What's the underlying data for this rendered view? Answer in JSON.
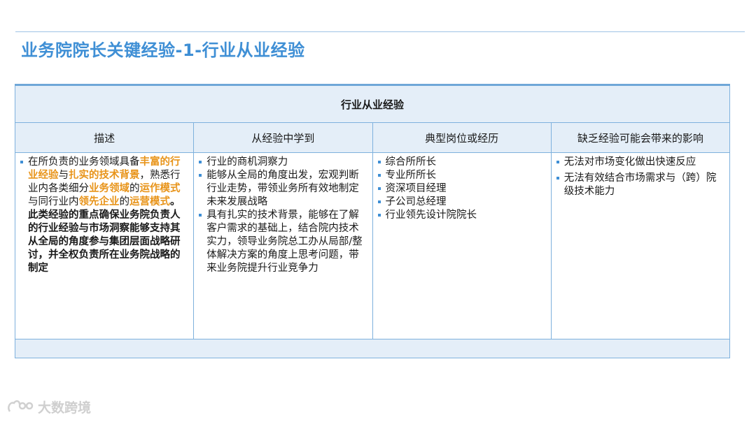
{
  "title": "业务院院长关键经验-1-行业从业经验",
  "table": {
    "header": "行业从业经验",
    "columns": [
      "描述",
      "从经验中学到",
      "典型岗位或经历",
      "缺乏经验可能会带来的影响"
    ],
    "description": {
      "p1": "在所负责的业务领域具备",
      "h1": "丰富的行业经验",
      "p2": "与",
      "h2": "扎实的技术背景",
      "p3": "，熟悉行业内各类细分",
      "h3": "业务领域",
      "p4": "的",
      "h4": "运作模式",
      "p5": "与同行业内",
      "h5": "领先企业",
      "p6": "的",
      "h6": "运营模式",
      "p7": "。此类经验的重点确保业务院负责人的行业经验与市场洞察能够支持其从全局的角度参与集团层面战略研讨，并全权负责所在业务院战略的制定"
    },
    "learned": [
      "行业的商机洞察力",
      "能够从全局的角度出发，宏观判断行业走势，带领业务所有效地制定未来发展战略",
      "具有扎实的技术背景，能够在了解客户需求的基础上，结合院内技术实力，领导业务院总工办从局部/整体解决方案的角度上思考问题，带来业务院提升行业竞争力"
    ],
    "positions": [
      "综合所所长",
      "专业所所长",
      "资深项目经理",
      "子公司总经理",
      "行业领先设计院院长"
    ],
    "impacts": [
      "无法对市场变化做出快速反应",
      "无法有效结合市场需求与（跨）院级技术能力"
    ]
  },
  "watermark": "大数跨境",
  "colors": {
    "accent": "#3f8fd5",
    "highlight": "#e8941a",
    "header_bg": "#e4eef8",
    "border": "#7eb1dd"
  }
}
